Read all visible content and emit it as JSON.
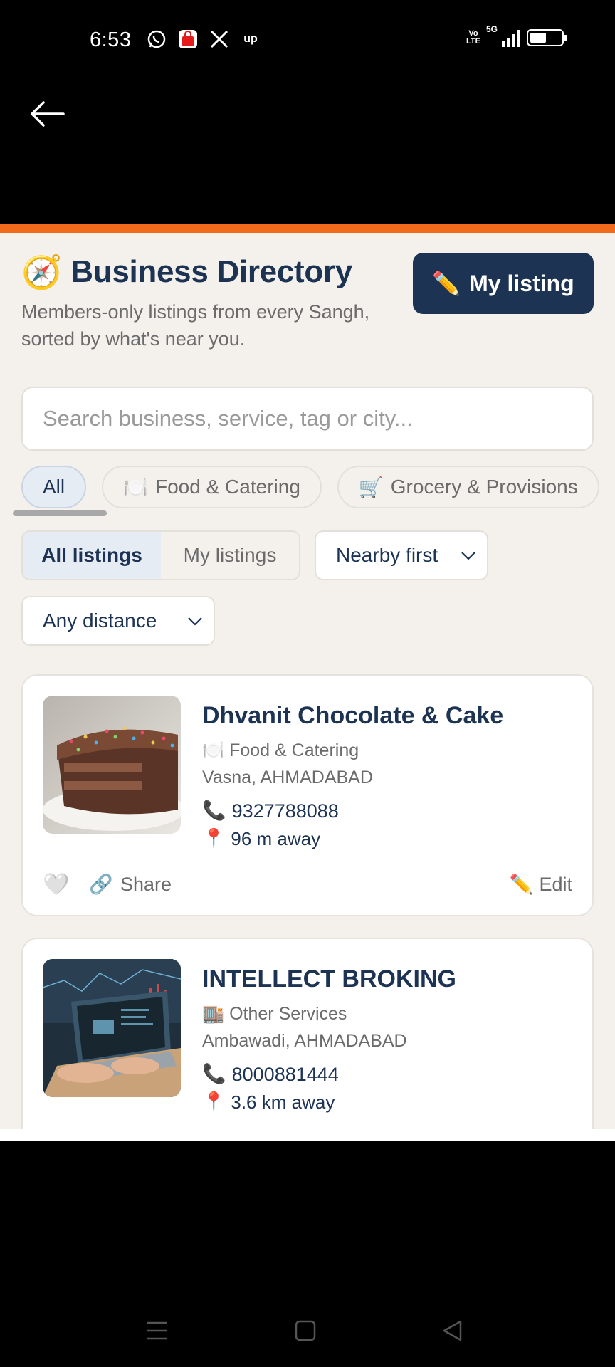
{
  "status_bar": {
    "time": "6:53",
    "left_icons": [
      "whatsapp-icon",
      "shopping-bag-icon",
      "x-logo-icon",
      "up-icon"
    ],
    "up_text": "up",
    "volte_top": "Vo",
    "volte_bottom": "LTE",
    "network": "5G",
    "battery_level": 0.45
  },
  "app_bar": {
    "back_icon": "arrow-left-icon"
  },
  "colors": {
    "accent": "#f26a1b",
    "primary": "#1d3354",
    "background": "#f4f1ec"
  },
  "header": {
    "title_icon": "🧭",
    "title": "Business Directory",
    "subtitle": "Members-only listings from every Sangh, sorted by what's near you.",
    "my_listing_icon": "✏️",
    "my_listing_label": "My listing"
  },
  "search": {
    "placeholder": "Search business, service, tag or city..."
  },
  "categories": [
    {
      "label": "All",
      "icon": "",
      "active": true
    },
    {
      "label": "Food & Catering",
      "icon": "🍽️",
      "active": false
    },
    {
      "label": "Grocery & Provisions",
      "icon": "🛒",
      "active": false
    }
  ],
  "filters": {
    "segment": [
      {
        "label": "All listings",
        "active": true
      },
      {
        "label": "My listings",
        "active": false
      }
    ],
    "sort_value": "Nearby first",
    "distance_value": "Any distance"
  },
  "listings": [
    {
      "name": "Dhvanit Chocolate & Cake",
      "category_icon": "🍽️",
      "category": "Food & Catering",
      "location": "Vasna, AHMADABAD",
      "phone_icon": "📞",
      "phone": "9327788088",
      "distance_icon": "📍",
      "distance": "96 m away",
      "heart_icon": "🤍",
      "share_icon": "🔗",
      "share_label": "Share",
      "edit_icon": "✏️",
      "edit_label": "Edit"
    },
    {
      "name": "INTELLECT BROKING",
      "category_icon": "🏬",
      "category": "Other Services",
      "location": "Ambawadi, AHMADABAD",
      "phone_icon": "📞",
      "phone": "8000881444",
      "distance_icon": "📍",
      "distance": "3.6 km away"
    }
  ]
}
